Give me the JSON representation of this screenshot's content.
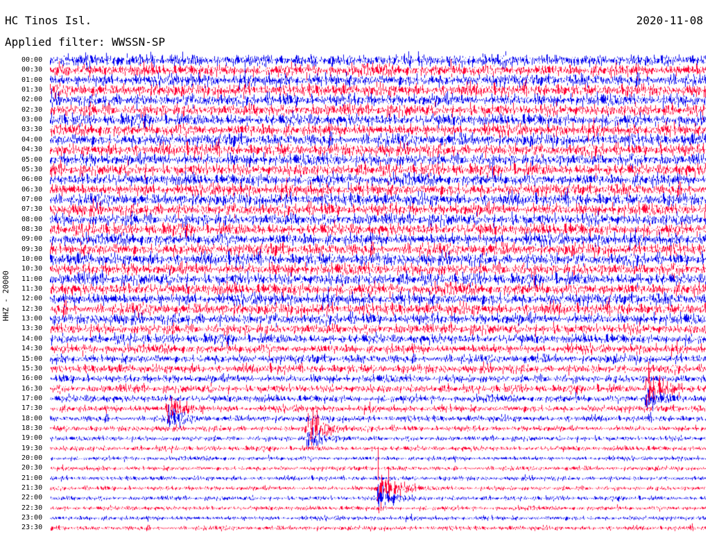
{
  "header": {
    "station": "HC Tinos Isl.",
    "date": "2020-11-08",
    "filter": "Applied filter: WWSSN-SP"
  },
  "colors": {
    "trace_a": "#0000ee",
    "trace_b": "#ff0033",
    "background": "#ffffff"
  },
  "chart_data": {
    "type": "line",
    "title": "",
    "ylabel": "HHZ - 20000",
    "row_labels": [
      "00:00",
      "00:30",
      "01:00",
      "01:30",
      "02:00",
      "02:30",
      "03:00",
      "03:30",
      "04:00",
      "04:30",
      "05:00",
      "05:30",
      "06:00",
      "06:30",
      "07:00",
      "07:30",
      "08:00",
      "08:30",
      "09:00",
      "09:30",
      "10:00",
      "10:30",
      "11:00",
      "11:30",
      "12:00",
      "12:30",
      "13:00",
      "13:30",
      "14:00",
      "14:30",
      "15:00",
      "15:30",
      "16:00",
      "16:30",
      "17:00",
      "17:30",
      "18:00",
      "18:30",
      "19:00",
      "19:30",
      "20:00",
      "20:30",
      "21:00",
      "21:30",
      "22:00",
      "22:30",
      "23:00",
      "23:30"
    ],
    "series_colors_alternating": [
      "#0000ee",
      "#ff0033"
    ],
    "noise_amplitude_relative": [
      1.0,
      1.0,
      1.0,
      1.0,
      1.0,
      1.0,
      1.0,
      1.0,
      1.0,
      1.0,
      1.0,
      1.0,
      1.0,
      1.0,
      1.0,
      1.0,
      1.0,
      1.0,
      1.0,
      1.0,
      1.0,
      1.0,
      1.0,
      1.0,
      1.0,
      0.95,
      0.9,
      0.85,
      0.8,
      0.75,
      0.7,
      0.7,
      0.65,
      0.65,
      0.6,
      0.55,
      0.5,
      0.45,
      0.4,
      0.4,
      0.35,
      0.35,
      0.35,
      0.35,
      0.35,
      0.35,
      0.35,
      0.35
    ],
    "events": [
      {
        "time": "17:45",
        "x_fraction": 0.18,
        "amplitude": 3.0
      },
      {
        "time": "18:30",
        "x_fraction": 0.4,
        "amplitude": 2.0
      },
      {
        "time": "18:45",
        "x_fraction": 0.39,
        "amplitude": 2.5
      },
      {
        "time": "21:45",
        "x_fraction": 0.5,
        "amplitude": 6.0
      },
      {
        "time": "16:45",
        "x_fraction": 0.91,
        "amplitude": 5.0
      }
    ]
  }
}
